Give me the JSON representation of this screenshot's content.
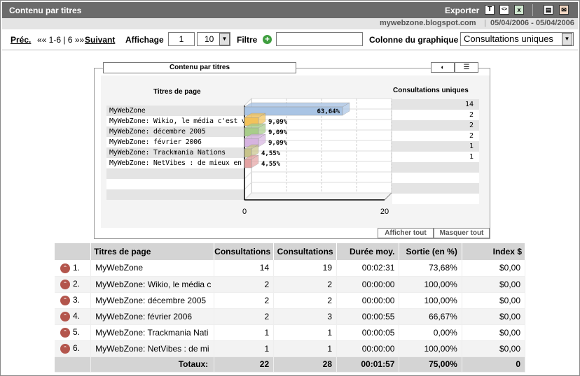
{
  "header": {
    "title": "Contenu par titres",
    "export_label": "Exporter",
    "site": "mywebzone.blogspot.com",
    "separator": "|",
    "date_range": "05/04/2006 - 05/04/2006"
  },
  "toolbar": {
    "prev_label": "Préc.",
    "pager_text": "«« 1-6 | 6 »»",
    "next_label": "Suivant",
    "display_label": "Affichage",
    "display_start": "1",
    "display_count": "10",
    "filter_label": "Filtre",
    "filter_value": "",
    "chart_column_label": "Colonne du graphique",
    "chart_column_value": "Consultations uniques"
  },
  "chart_panel": {
    "tab_title": "Contenu par titres",
    "labels_header": "Titres de page",
    "values_header": "Consultations uniques",
    "show_all": "Afficher tout",
    "hide_all": "Masquer tout"
  },
  "chart_data": {
    "type": "bar",
    "orientation": "horizontal",
    "categories": [
      "MyWebZone",
      "MyWebZone: Wikio, le média c'est v",
      "MyWebZone: décembre 2005",
      "MyWebZone: février 2006",
      "MyWebZone: Trackmania Nations",
      "MyWebZone: NetVibes : de mieux en"
    ],
    "values": [
      14,
      2,
      2,
      2,
      1,
      1
    ],
    "percent_labels": [
      "63,64%",
      "9,09%",
      "9,09%",
      "9,09%",
      "4,55%",
      "4,55%"
    ],
    "value_labels": [
      "14",
      "2",
      "2",
      "2",
      "1",
      "1"
    ],
    "colors": [
      "#a9c4e4",
      "#f2c25a",
      "#a8cd8a",
      "#d6b3e0",
      "#c8c48a",
      "#e4a2a2"
    ],
    "xlim": [
      0,
      20
    ],
    "x_tick_labels": [
      "0",
      "20"
    ],
    "grid": true
  },
  "table": {
    "columns": [
      "Titres de page",
      "Consultations",
      "Consultations",
      "Durée moy.",
      "Sortie (en %)",
      "Index $"
    ],
    "rows": [
      {
        "rank": "1.",
        "title": "MyWebZone",
        "unique": "14",
        "views": "19",
        "duration": "00:02:31",
        "exit": "73,68%",
        "index": "$0,00"
      },
      {
        "rank": "2.",
        "title": "MyWebZone: Wikio, le média c",
        "unique": "2",
        "views": "2",
        "duration": "00:00:00",
        "exit": "100,00%",
        "index": "$0,00"
      },
      {
        "rank": "3.",
        "title": "MyWebZone: décembre 2005",
        "unique": "2",
        "views": "2",
        "duration": "00:00:00",
        "exit": "100,00%",
        "index": "$0,00"
      },
      {
        "rank": "4.",
        "title": "MyWebZone: février 2006",
        "unique": "2",
        "views": "3",
        "duration": "00:00:55",
        "exit": "66,67%",
        "index": "$0,00"
      },
      {
        "rank": "5.",
        "title": "MyWebZone: Trackmania Nati",
        "unique": "1",
        "views": "1",
        "duration": "00:00:05",
        "exit": "0,00%",
        "index": "$0,00"
      },
      {
        "rank": "6.",
        "title": "MyWebZone: NetVibes : de mi",
        "unique": "1",
        "views": "1",
        "duration": "00:00:00",
        "exit": "100,00%",
        "index": "$0,00"
      }
    ],
    "totals": {
      "label": "Totaux:",
      "unique": "22",
      "views": "28",
      "duration": "00:01:57",
      "exit": "75,00%",
      "index": "0"
    }
  },
  "icons": {
    "export_text": "T",
    "export_xml": "xml-icon",
    "export_excel": "excel-icon",
    "print": "printer-icon",
    "email": "email-icon",
    "add_filter": "plus-circle-icon",
    "chart_pie": "pie-chart-icon",
    "chart_bar": "bar-chart-icon",
    "rank_arrow": "up-arrow-icon"
  }
}
